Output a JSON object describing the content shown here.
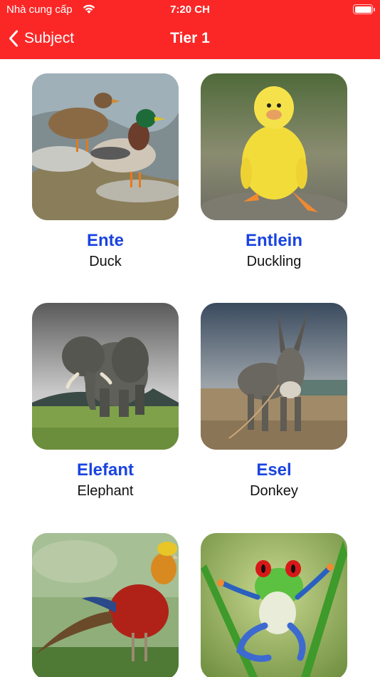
{
  "status_bar": {
    "carrier": "Nhà cung cấp",
    "time": "7:20 CH"
  },
  "nav": {
    "back_label": "Subject",
    "title": "Tier 1"
  },
  "colors": {
    "nav_background": "#fb2727",
    "word_color": "#1a44e0"
  },
  "items": [
    {
      "word": "Ente",
      "translation": "Duck",
      "image": "duck-photo"
    },
    {
      "word": "Entlein",
      "translation": "Duckling",
      "image": "duckling-photo"
    },
    {
      "word": "Elefant",
      "translation": "Elephant",
      "image": "elephant-photo"
    },
    {
      "word": "Esel",
      "translation": "Donkey",
      "image": "donkey-photo"
    },
    {
      "word": "",
      "translation": "",
      "image": "pheasant-photo"
    },
    {
      "word": "",
      "translation": "",
      "image": "frog-photo"
    }
  ]
}
